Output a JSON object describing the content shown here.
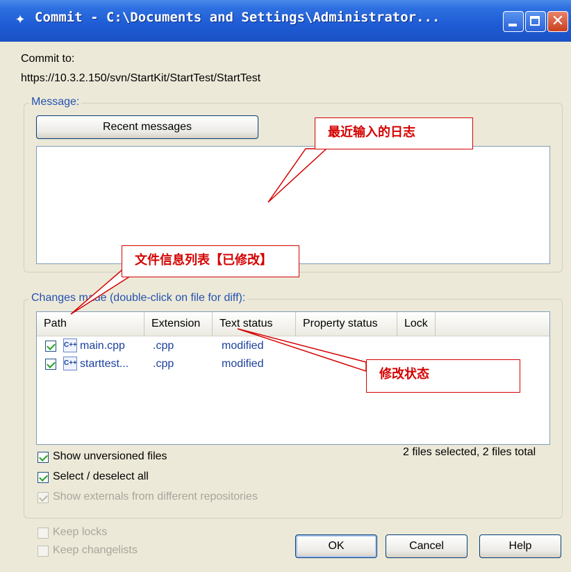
{
  "window": {
    "title": "Commit - C:\\Documents and Settings\\Administrator...",
    "icon": "tortoise-svn-icon"
  },
  "commit_to_label": "Commit to:",
  "repo_url": "https://10.3.2.150/svn/StartKit/StartTest/StartTest",
  "message_group": {
    "legend": "Message:",
    "recent_button": "Recent messages",
    "text": ""
  },
  "changes_group": {
    "legend": "Changes made (double-click on file for diff):",
    "columns": [
      "Path",
      "Extension",
      "Text status",
      "Property status",
      "Lock"
    ],
    "files": [
      {
        "checked": true,
        "path": "main.cpp",
        "extension": ".cpp",
        "text_status": "modified",
        "property_status": "",
        "lock": ""
      },
      {
        "checked": true,
        "path": "starttest...",
        "extension": ".cpp",
        "text_status": "modified",
        "property_status": "",
        "lock": ""
      }
    ],
    "summary": "2 files selected, 2 files total"
  },
  "options": {
    "show_unversioned": {
      "label": "Show unversioned files",
      "checked": true,
      "enabled": true
    },
    "select_all": {
      "label": "Select / deselect all",
      "checked": true,
      "enabled": true
    },
    "show_externals": {
      "label": "Show externals from different repositories",
      "checked": true,
      "enabled": false
    },
    "keep_locks": {
      "label": "Keep locks",
      "checked": false,
      "enabled": false
    },
    "keep_changelists": {
      "label": "Keep changelists",
      "checked": false,
      "enabled": false
    }
  },
  "buttons": {
    "ok": "OK",
    "cancel": "Cancel",
    "help": "Help"
  },
  "annotations": {
    "recent_log": "最近输入的日志",
    "file_list": "文件信息列表【已修改】",
    "modified_status": "修改状态"
  },
  "colors": {
    "annotation": "#d40000",
    "titlebar": "#1e5bd4",
    "dialog_bg": "#ece9d8",
    "legend": "#2450b0"
  }
}
